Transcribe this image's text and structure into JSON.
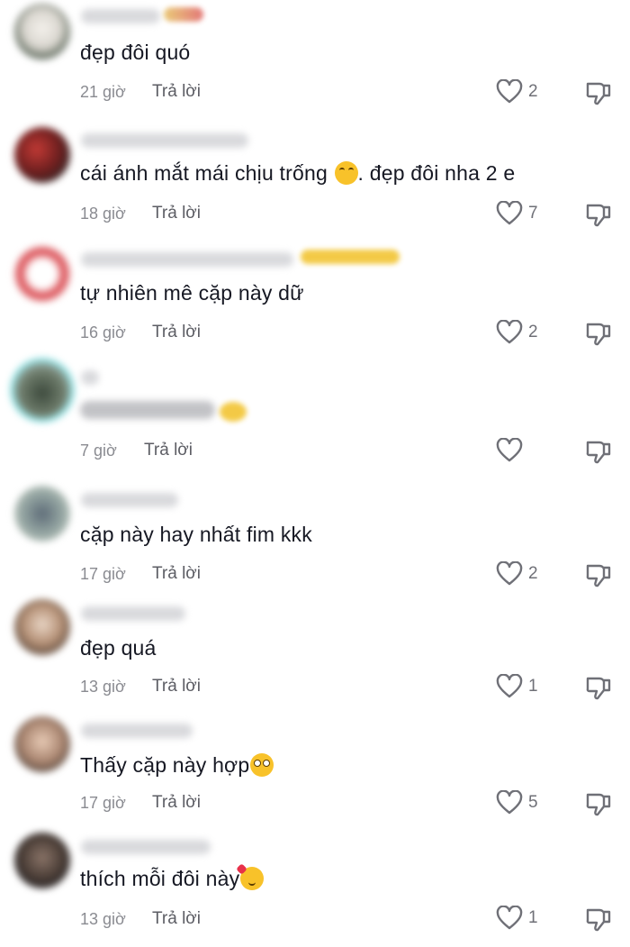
{
  "labels": {
    "reply": "Trả lời"
  },
  "comments": [
    {
      "text": "đẹp đôi quó",
      "emoji": "",
      "time": "21 giờ",
      "likes": "2"
    },
    {
      "text": "cái ánh mắt mái chịu trống ",
      "emoji": "laugh",
      "text_after": ". đẹp đôi nha 2 e",
      "time": "18 giờ",
      "likes": "7"
    },
    {
      "text": "tự nhiên mê cặp này dữ",
      "emoji": "",
      "time": "16 giờ",
      "likes": "2"
    },
    {
      "text": "",
      "emoji": "",
      "time": "7 giờ",
      "likes": ""
    },
    {
      "text": "cặp này hay nhất fim kkk",
      "emoji": "",
      "time": "17 giờ",
      "likes": "2"
    },
    {
      "text": "đẹp quá",
      "emoji": "",
      "time": "13 giờ",
      "likes": "1"
    },
    {
      "text": "Thấy cặp này hợp",
      "emoji": "flushed",
      "time": "17 giờ",
      "likes": "5"
    },
    {
      "text": "thích mỗi đôi này",
      "emoji": "hearts",
      "time": "13 giờ",
      "likes": "1"
    }
  ],
  "icons": {
    "like": "heart-outline-icon",
    "dislike": "thumbs-down-outline-icon"
  },
  "colors": {
    "text": "#161823",
    "meta": "#8a8b91",
    "icon": "#6f7077"
  }
}
